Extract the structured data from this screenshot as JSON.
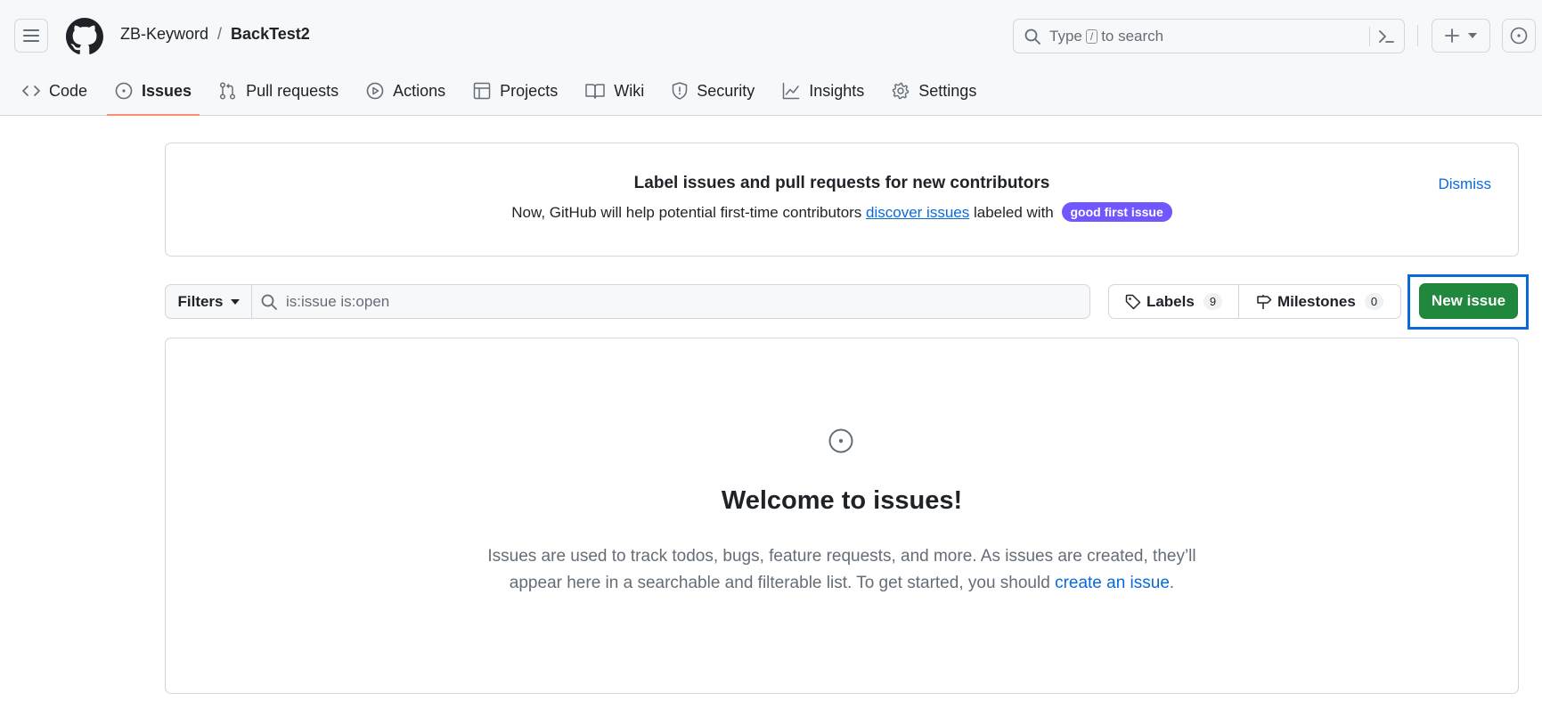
{
  "header": {
    "owner": "ZB-Keyword",
    "separator": "/",
    "repo": "BackTest2",
    "search_prefix": "Type",
    "search_key": "/",
    "search_suffix": "to search"
  },
  "tabs": [
    {
      "label": "Code",
      "icon": "code-icon",
      "active": false
    },
    {
      "label": "Issues",
      "icon": "issue-opened-icon",
      "active": true
    },
    {
      "label": "Pull requests",
      "icon": "git-pull-request-icon",
      "active": false
    },
    {
      "label": "Actions",
      "icon": "play-icon",
      "active": false
    },
    {
      "label": "Projects",
      "icon": "table-icon",
      "active": false
    },
    {
      "label": "Wiki",
      "icon": "book-icon",
      "active": false
    },
    {
      "label": "Security",
      "icon": "shield-icon",
      "active": false
    },
    {
      "label": "Insights",
      "icon": "graph-icon",
      "active": false
    },
    {
      "label": "Settings",
      "icon": "gear-icon",
      "active": false
    }
  ],
  "banner": {
    "title": "Label issues and pull requests for new contributors",
    "text_before": "Now, GitHub will help potential first-time contributors ",
    "link": "discover issues",
    "text_after": " labeled with",
    "label": "good first issue",
    "dismiss": "Dismiss"
  },
  "filters": {
    "button": "Filters",
    "query": "is:issue is:open"
  },
  "labels": {
    "label": "Labels",
    "count": "9"
  },
  "milestones": {
    "label": "Milestones",
    "count": "0"
  },
  "new_issue": "New issue",
  "blank_slate": {
    "title": "Welcome to issues!",
    "line1": "Issues are used to track todos, bugs, feature requests, and more. As issues are created, they’ll",
    "line2_before": "appear here in a searchable and filterable list. To get started, you should ",
    "link": "create an issue",
    "line2_after": "."
  },
  "colors": {
    "accent_link": "#0969da",
    "primary_button": "#1f883d",
    "active_tab_underline": "#fd8c73",
    "good_first_issue_label": "#7057ff",
    "highlight_outline": "#0b6bd6"
  }
}
